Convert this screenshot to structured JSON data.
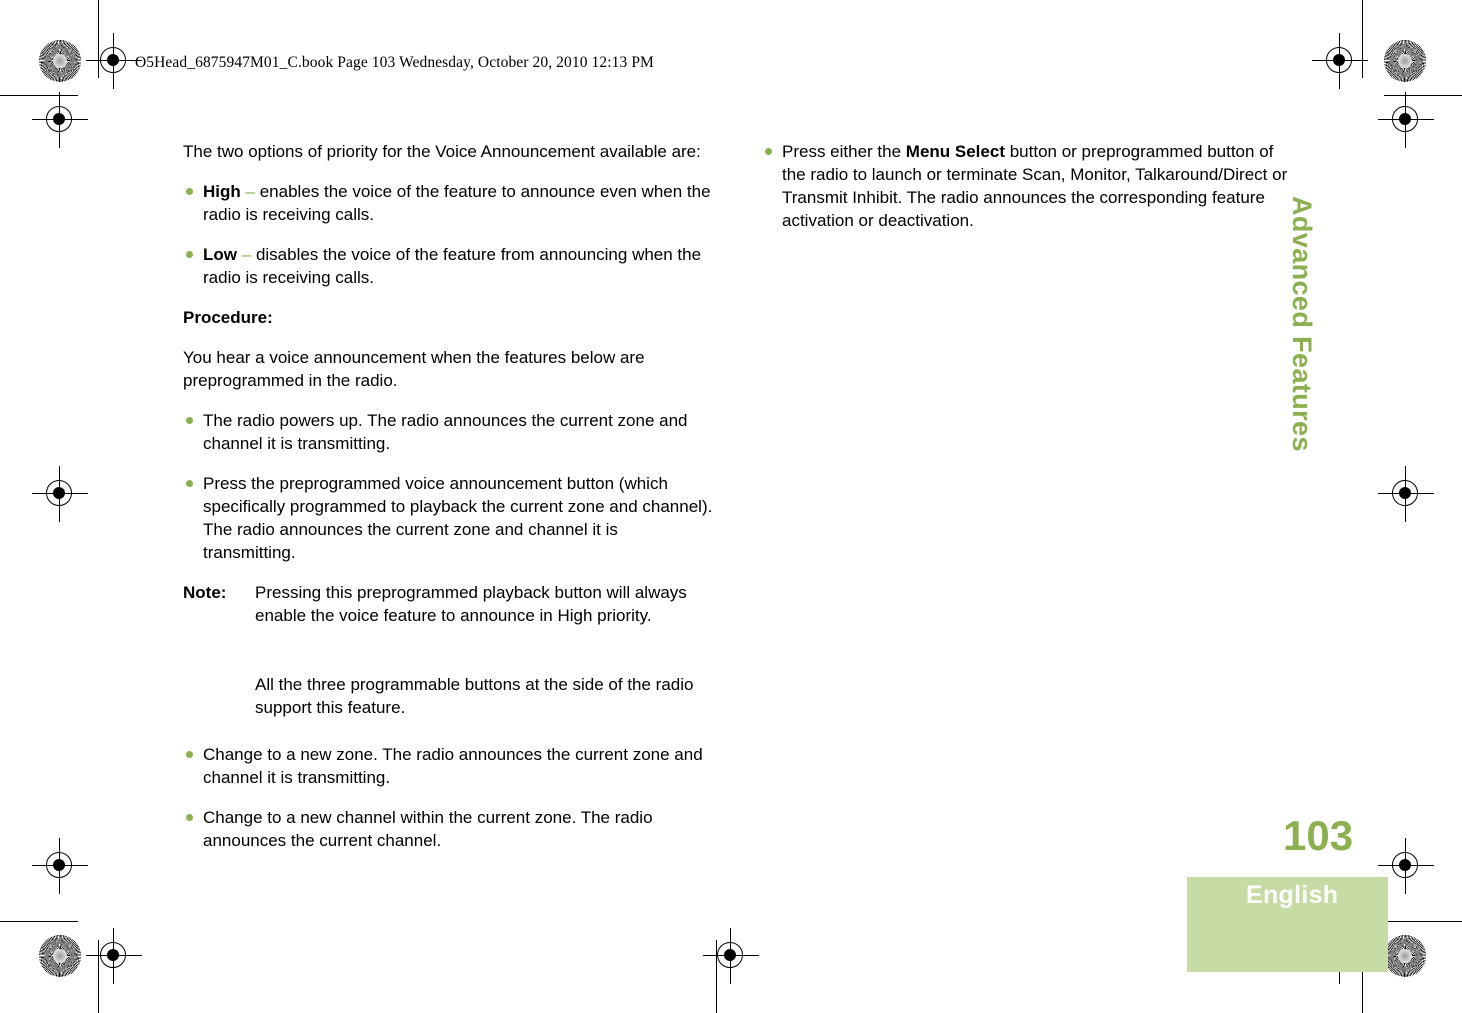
{
  "header": {
    "slug": "O5Head_6875947M01_C.book  Page 103  Wednesday, October 20, 2010  12:13 PM"
  },
  "colors": {
    "accent_green": "#8CB04F",
    "tab_fill_green": "#C6DCA4",
    "text_black": "#000000",
    "lang_label_white": "#FFFFFF"
  },
  "left_column": {
    "intro": "The two options of priority for the Voice Announcement available are:",
    "priority_options": [
      {
        "term": "High",
        "dash": "–",
        "text": "enables the voice of the feature to announce even when the radio is receiving calls."
      },
      {
        "term": "Low",
        "dash": "–",
        "text": "disables the voice of the feature from announcing when the radio is receiving calls."
      }
    ],
    "procedure_heading": "Procedure:",
    "procedure_intro": "You hear a voice announcement when the features below are preprogrammed in the radio.",
    "procedure_bullets_first": [
      "The radio powers up. The radio announces the current zone and channel it is transmitting.",
      "Press the preprogrammed voice announcement button (which specifically programmed to playback the current zone and channel). The radio announces the current zone and channel it is transmitting."
    ],
    "note": {
      "label": "Note:",
      "paragraph_1": "Pressing this preprogrammed playback button will always enable the voice feature to announce in High priority.",
      "paragraph_2": "All the three programmable buttons at the side of the radio support this feature."
    },
    "procedure_bullets_second": [
      "Change to a new zone. The radio announces the current zone and channel it is transmitting.",
      "Change to a new channel within the current zone. The radio announces the current channel."
    ]
  },
  "right_column": {
    "bullets": [
      {
        "text_before": "Press either the ",
        "bold_term": "Menu Select",
        "text_after": " button or preprogrammed button of the radio to launch or terminate Scan, Monitor, Talkaround/Direct or Transmit Inhibit. The radio announces the corresponding feature activation or deactivation."
      }
    ]
  },
  "sidebar": {
    "chapter_tab_label": "Advanced Features"
  },
  "footer": {
    "page_number": "103",
    "language_label": "English"
  },
  "print_marks": {
    "registration_icon": "registration-crosshair",
    "resolution_icon": "starburst-resolution-target"
  }
}
